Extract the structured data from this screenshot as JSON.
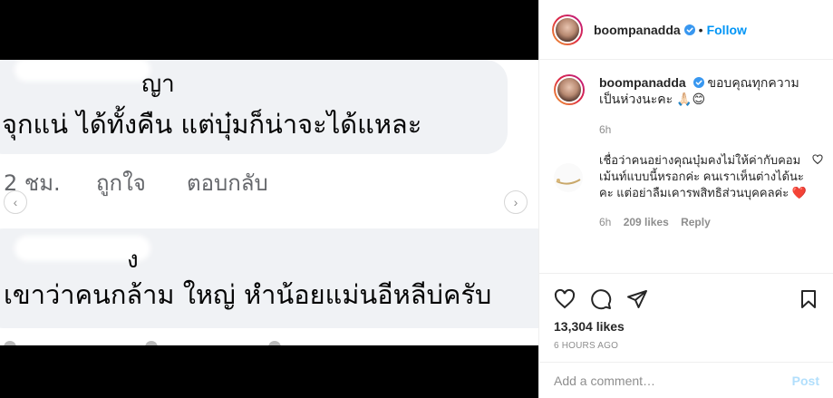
{
  "media": {
    "comment1": {
      "name_tail": "ญา",
      "text": "จุกแน่ ได้ทั้งคืน แต่บุ๋มก็น่าจะได้แหละ",
      "time": "2 ชม.",
      "like": "ถูกใจ",
      "reply": "ตอบกลับ"
    },
    "comment2": {
      "name_tail": "ง",
      "text": "เขาว่าคนกล้าม ใหญ่ หำน้อยแม่นอีหลีบ่ครับ"
    },
    "arrow_left": "‹",
    "arrow_right": "›"
  },
  "header": {
    "username": "boompanadda",
    "separator": "•",
    "follow": "Follow"
  },
  "caption": {
    "username": "boompanadda",
    "text": "ขอบคุณทุกความเป็นห่วงนะคะ 🙏🏻😊",
    "time": "6h"
  },
  "comment": {
    "text": "เชื่อว่าคนอย่างคุณบุ๋มคงไม่ให้ค่ากับคอมเม้นท์แบบนี้หรอกค่ะ คนเราเห็นต่างได้นะคะ แต่อย่าลืมเคารพสิทธิส่วนบุคคลค่ะ ❤️",
    "time": "6h",
    "likes": "209 likes",
    "reply": "Reply"
  },
  "actions": {
    "likes": "13,304 likes",
    "time": "6 HOURS AGO"
  },
  "add_comment": {
    "placeholder": "Add a comment…",
    "post": "Post"
  },
  "colors": {
    "link_blue": "#0095f6",
    "post_disabled": "#b2dffc",
    "muted": "#8e8e8e",
    "text": "#262626"
  }
}
